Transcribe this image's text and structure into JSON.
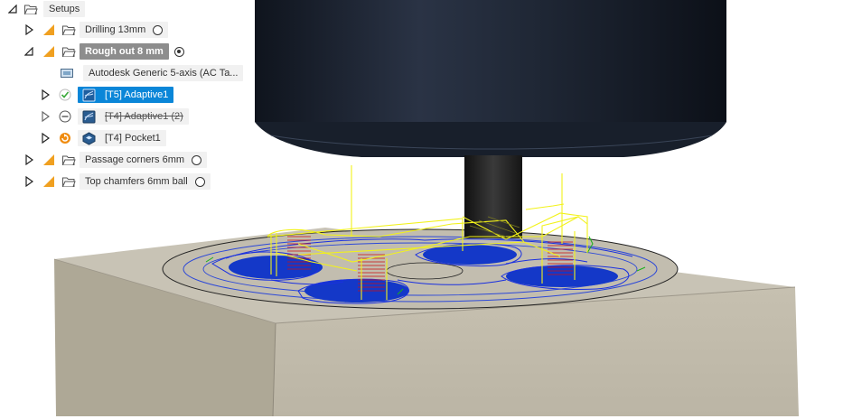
{
  "browser": {
    "root": {
      "label": "Setups"
    },
    "items": [
      {
        "label": "Drilling 13mm",
        "radio": "off"
      },
      {
        "label": "Rough out 8 mm",
        "radio": "on"
      },
      {
        "label": "Autodesk Generic 5-axis (AC Ta..."
      },
      {
        "label": "[T5] Adaptive1",
        "status": "ok"
      },
      {
        "label": "[T4] Adaptive1 (2)",
        "status": "suppressed"
      },
      {
        "label": "[T4] Pocket1",
        "status": "pending"
      },
      {
        "label": "Passage corners 6mm",
        "radio": "off"
      },
      {
        "label": "Top chamfers 6mm ball",
        "radio": "off"
      }
    ]
  },
  "colors": {
    "setup_icon": "#f0a020",
    "selection": "#0a86d8",
    "active_setup": "#8d8d8d",
    "stock_top": "#c8c3b5",
    "stock_front": "#bdb7a7",
    "stock_side": "#aba593",
    "tool_body": "#1b2230",
    "toolpath_yellow": "#f4f414",
    "toolpath_blue": "#1030d8",
    "plunge_red": "#cc1010"
  },
  "icons": {
    "expand": "triangle-right-icon",
    "collapse": "triangle-down-icon",
    "setup": "setup-icon",
    "folder": "folder-icon",
    "machine": "machine-icon",
    "adaptive": "adaptive-operation-icon",
    "pocket": "pocket-operation-icon",
    "ok": "check-icon",
    "suppressed": "suppressed-icon",
    "pending": "regenerate-icon"
  }
}
